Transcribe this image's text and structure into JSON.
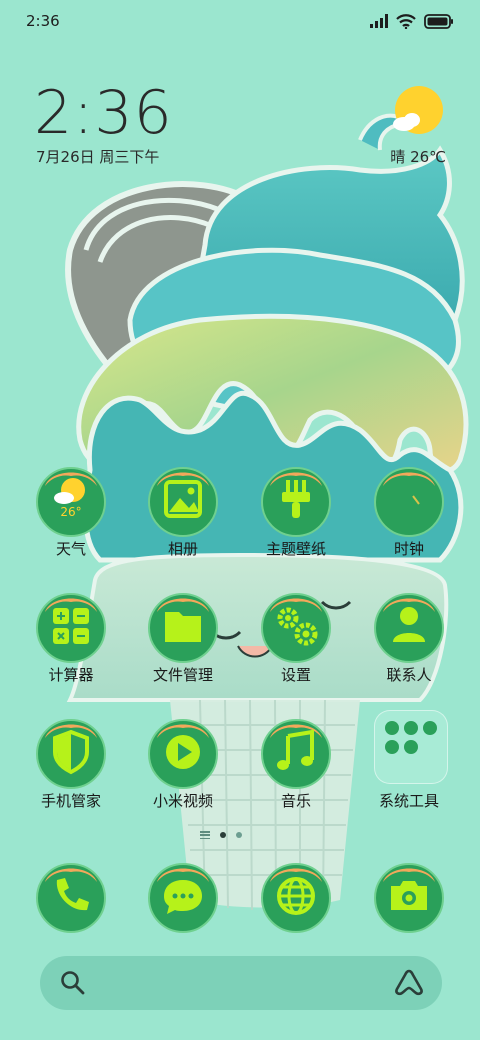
{
  "status_bar": {
    "time": "2:36",
    "icons": [
      "signal-icon",
      "wifi-icon",
      "battery-icon"
    ]
  },
  "clock_widget": {
    "time": "2:36",
    "date": "7月26日 周三下午",
    "weather": "晴 26℃",
    "weather_icon": "sun-cloud-icon"
  },
  "apps": [
    {
      "label": "天气",
      "icon": "weather-icon",
      "temp": "26°"
    },
    {
      "label": "相册",
      "icon": "gallery-icon"
    },
    {
      "label": "主题壁纸",
      "icon": "themes-icon"
    },
    {
      "label": "时钟",
      "icon": "clock-icon"
    },
    {
      "label": "计算器",
      "icon": "calculator-icon"
    },
    {
      "label": "文件管理",
      "icon": "folder-icon"
    },
    {
      "label": "设置",
      "icon": "settings-icon"
    },
    {
      "label": "联系人",
      "icon": "contacts-icon"
    },
    {
      "label": "手机管家",
      "icon": "security-icon"
    },
    {
      "label": "小米视频",
      "icon": "video-icon"
    },
    {
      "label": "音乐",
      "icon": "music-icon"
    },
    {
      "label": "系统工具",
      "icon": "folder-system-tools-icon"
    }
  ],
  "dock": [
    {
      "icon": "phone-icon"
    },
    {
      "icon": "messages-icon"
    },
    {
      "icon": "browser-icon"
    },
    {
      "icon": "camera-icon"
    }
  ],
  "page_indicator": {
    "pages": 2,
    "current": 1
  },
  "search_bar": {
    "left_icon": "search-icon",
    "right_icon": "assistant-icon"
  },
  "colors": {
    "background": "#9be6cf",
    "icon_green": "#2aa05a",
    "glyph_lime": "#b6f21a",
    "sun": "#ffd22e"
  }
}
